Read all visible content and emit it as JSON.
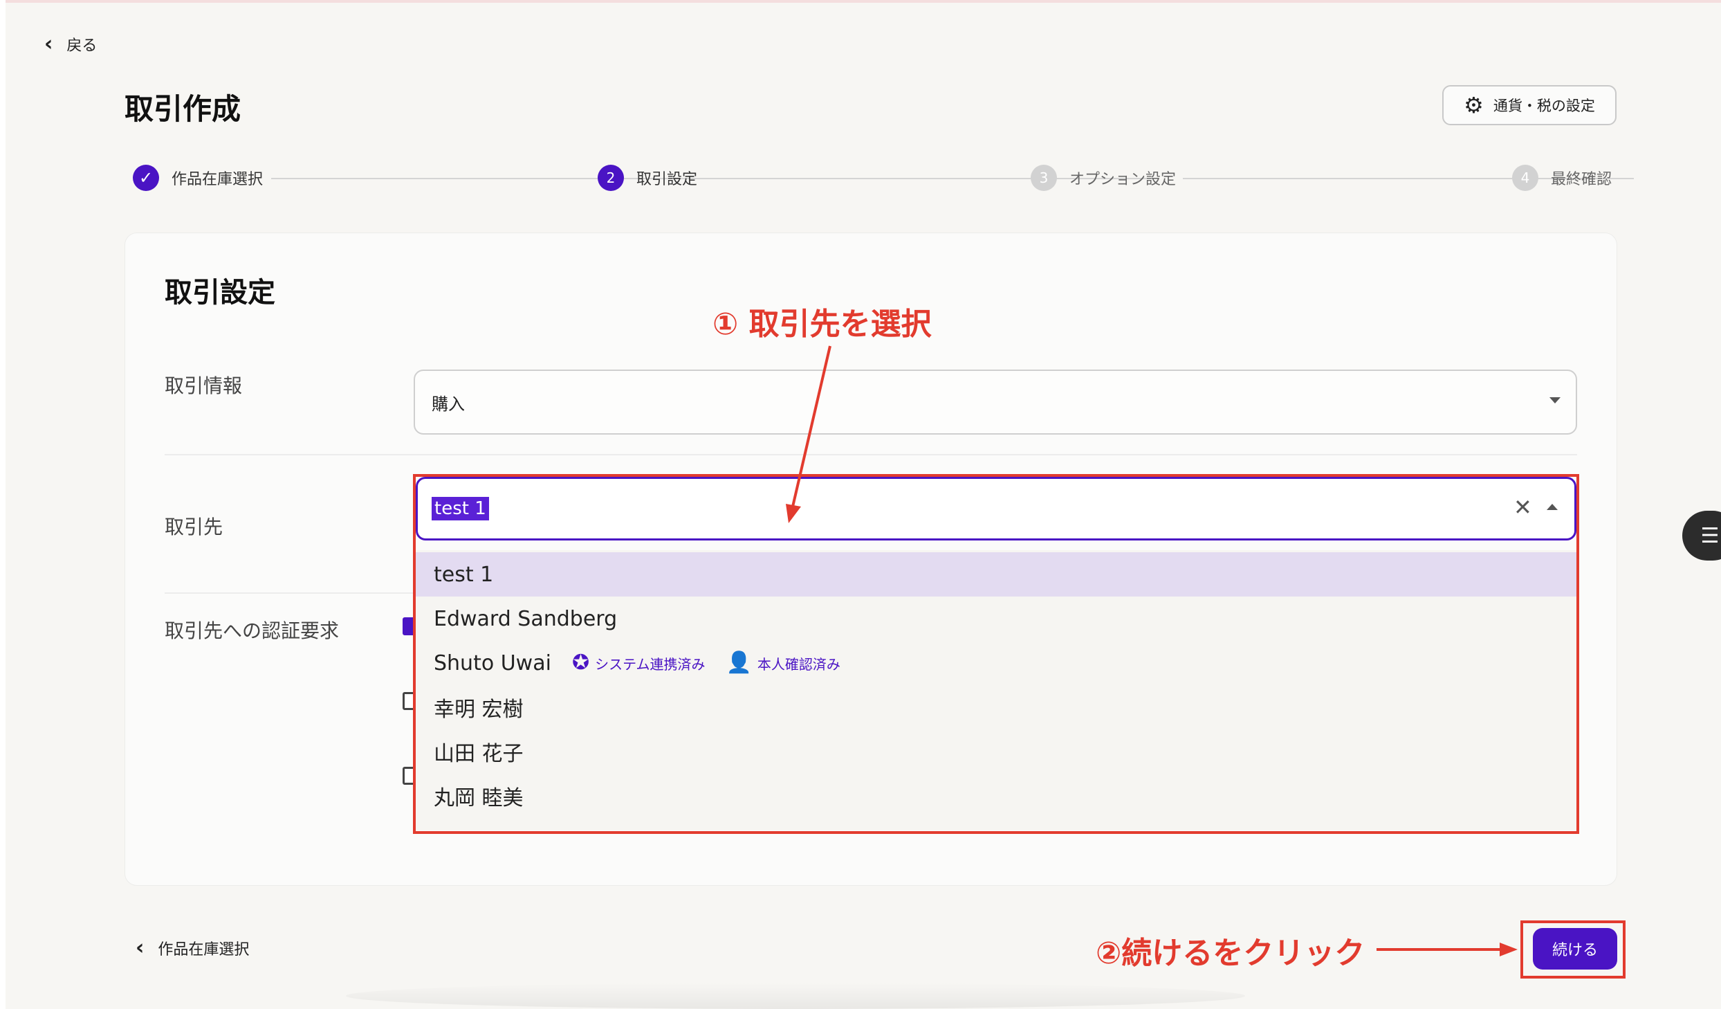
{
  "header": {
    "back_label": "戻る",
    "page_title": "取引作成",
    "settings_label": "通貨・税の設定"
  },
  "steps": [
    {
      "label": "作品在庫選択",
      "number": "",
      "status": "done"
    },
    {
      "label": "取引設定",
      "number": "2",
      "status": "current"
    },
    {
      "label": "オプション設定",
      "number": "3",
      "status": "pending"
    },
    {
      "label": "最終確認",
      "number": "4",
      "status": "pending"
    }
  ],
  "form": {
    "section_title": "取引設定",
    "transaction_info_label": "取引情報",
    "transaction_info_value": "購入",
    "partner_label": "取引先",
    "partner_value": "test 1",
    "auth_label": "取引先への認証要求"
  },
  "dropdown": {
    "options": [
      {
        "label": "test 1"
      },
      {
        "label": "Edward Sandberg"
      },
      {
        "label": "Shuto Uwai",
        "badges": [
          "システム連携済み",
          "本人確認済み"
        ]
      },
      {
        "label": "幸明 宏樹"
      },
      {
        "label": "山田 花子"
      },
      {
        "label": "丸岡 睦美"
      }
    ]
  },
  "annotations": {
    "step1": "① 取引先を選択",
    "step2": "②続けるをクリック"
  },
  "footer": {
    "prev_label": "作品在庫選択",
    "continue_label": "続ける"
  },
  "icons": {
    "back": "chevron-left-icon",
    "settings": "gear-icon",
    "verified": "verified-badge-icon",
    "identity": "person-check-icon",
    "clear": "close-icon",
    "float": "list-icon"
  },
  "colors": {
    "accent": "#4a14c4",
    "annotation": "#e23b2e",
    "selected_option": "#e3dbf1"
  }
}
